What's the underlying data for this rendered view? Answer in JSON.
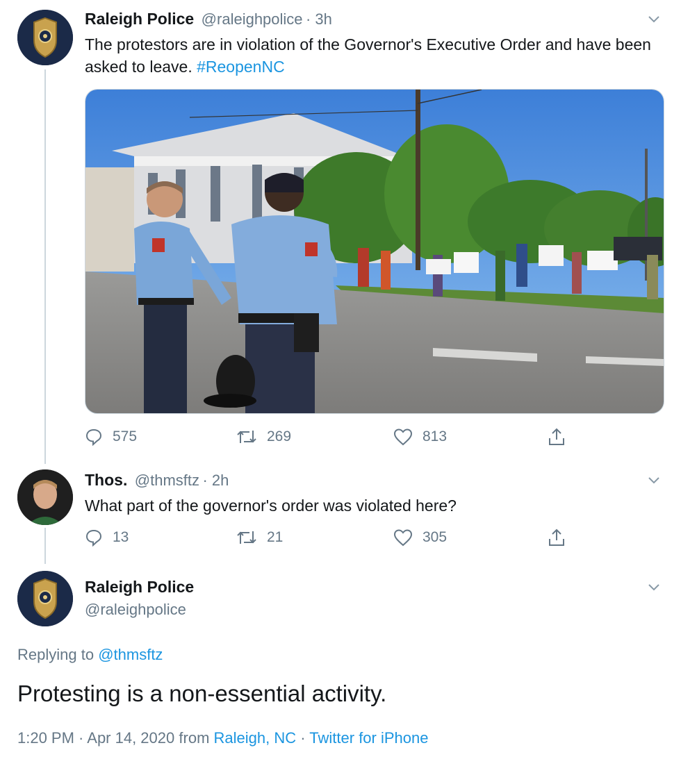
{
  "tweet1": {
    "name": "Raleigh Police",
    "handle": "@raleighpolice",
    "time": "· 3h",
    "text": "The protestors are in violation of the Governor's Executive Order and have been asked to leave.",
    "hashtag": "#ReopenNC",
    "replies": "575",
    "retweets": "269",
    "likes": "813"
  },
  "tweet2": {
    "name": "Thos.",
    "handle": "@thmsftz",
    "time": "· 2h",
    "text": "What part of the governor's order was violated here?",
    "replies": "13",
    "retweets": "21",
    "likes": "305"
  },
  "tweet3": {
    "name": "Raleigh Police",
    "handle": "@raleighpolice",
    "replying_prefix": "Replying to",
    "replying_to": "@thmsftz",
    "text": "Protesting is a non-essential activity.",
    "time_date": "1:20 PM · Apr 14, 2020",
    "from_word": "from",
    "location": "Raleigh, NC",
    "separator": "·",
    "source": "Twitter for iPhone"
  },
  "icons": {
    "reply": "reply-icon",
    "retweet": "retweet-icon",
    "like": "heart-icon",
    "share": "share-icon",
    "more": "chevron-down-icon"
  },
  "colors": {
    "link": "#1b95e0",
    "secondary": "#657786",
    "primary_text": "#14171a",
    "thread_line": "#ccd6dd"
  }
}
